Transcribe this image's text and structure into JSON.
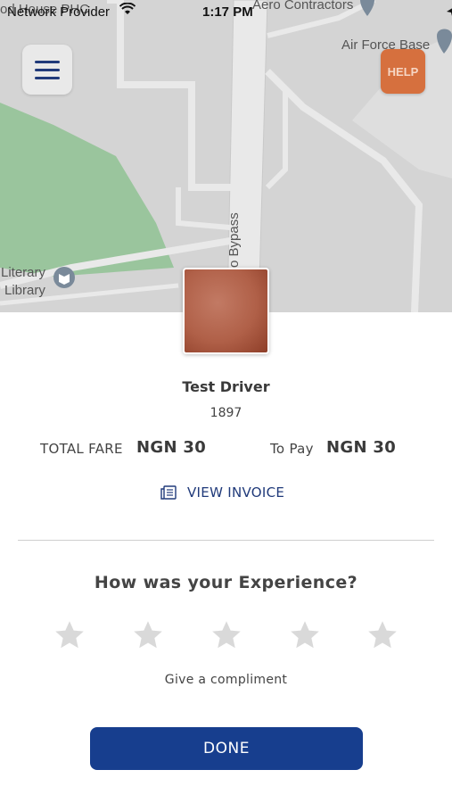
{
  "status_bar": {
    "carrier": "Network Provider",
    "time": "1:17 PM"
  },
  "map": {
    "labels": {
      "top_left": "od House PHC",
      "top_right": "Aero Contractors",
      "air_force": "Air Force Base",
      "road": "o Bypass",
      "library_line1": "Literary",
      "library_line2": "Library"
    },
    "park_color": "#8fc293",
    "road_color": "#e9e9e9"
  },
  "buttons": {
    "menu_icon": "hamburger-menu-icon",
    "help_label": "HELP",
    "help_color": "#d6703e"
  },
  "driver": {
    "name": "Test Driver",
    "id": "1897"
  },
  "fare": {
    "total_label": "TOTAL FARE",
    "total_value": "NGN 30",
    "to_pay_label": "To Pay",
    "to_pay_value": "NGN 30"
  },
  "invoice": {
    "label": "VIEW INVOICE",
    "icon": "invoice-icon"
  },
  "rating": {
    "question": "How was your Experience?",
    "stars": 5,
    "selected": 0,
    "compliment_label": "Give a compliment"
  },
  "done": {
    "label": "DONE",
    "color": "#173e8e"
  }
}
